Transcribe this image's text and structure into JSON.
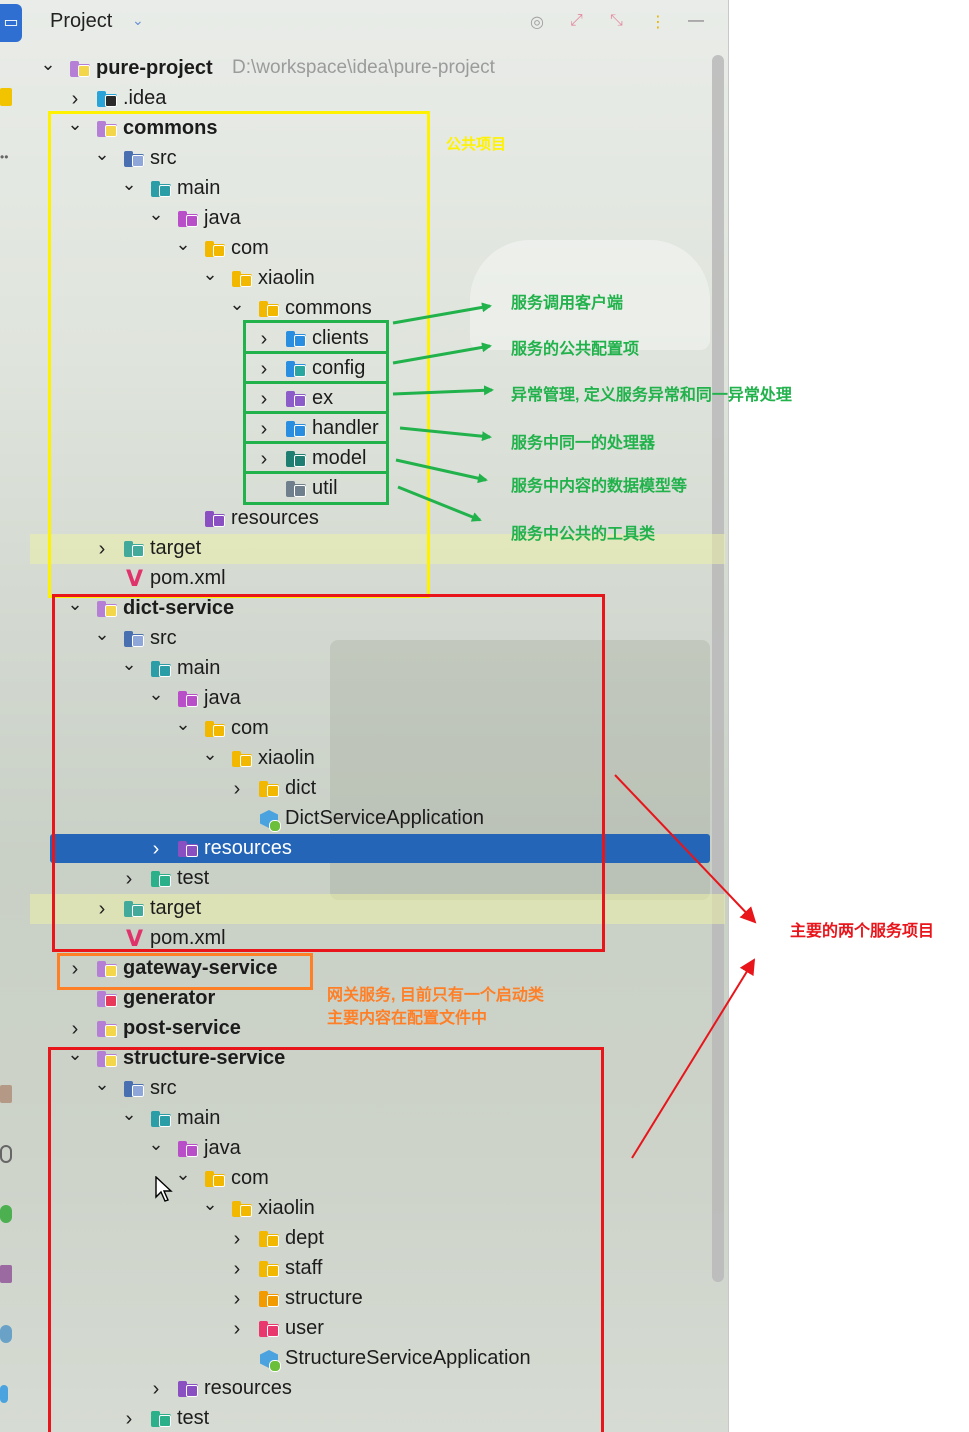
{
  "header": {
    "title": "Project",
    "chevron_icon": "chevron-down-icon",
    "icons": [
      "target-icon",
      "expand-icon",
      "collapse-icon",
      "more-vert-icon",
      "minimize-icon"
    ]
  },
  "tree": [
    {
      "depth": 0,
      "expanded": true,
      "icon": "module",
      "label": "pure-project",
      "bold": true,
      "path": "D:\\workspace\\idea\\pure-project"
    },
    {
      "depth": 1,
      "expanded": false,
      "icon": "idea",
      "label": ".idea"
    },
    {
      "depth": 1,
      "expanded": true,
      "icon": "module",
      "label": "commons",
      "bold": true
    },
    {
      "depth": 2,
      "expanded": true,
      "icon": "src",
      "label": "src"
    },
    {
      "depth": 3,
      "expanded": true,
      "icon": "main",
      "label": "main"
    },
    {
      "depth": 4,
      "expanded": true,
      "icon": "java",
      "label": "java"
    },
    {
      "depth": 5,
      "expanded": true,
      "icon": "package",
      "label": "com"
    },
    {
      "depth": 6,
      "expanded": true,
      "icon": "package",
      "label": "xiaolin"
    },
    {
      "depth": 7,
      "expanded": true,
      "icon": "package",
      "label": "commons"
    },
    {
      "depth": 8,
      "expanded": false,
      "icon": "clients",
      "label": "clients"
    },
    {
      "depth": 8,
      "expanded": false,
      "icon": "config",
      "label": "config"
    },
    {
      "depth": 8,
      "expanded": false,
      "icon": "ex",
      "label": "ex"
    },
    {
      "depth": 8,
      "expanded": false,
      "icon": "handler",
      "label": "handler"
    },
    {
      "depth": 8,
      "expanded": false,
      "icon": "model",
      "label": "model"
    },
    {
      "depth": 8,
      "expanded": null,
      "icon": "util",
      "label": "util"
    },
    {
      "depth": 5,
      "expanded": null,
      "icon": "resources",
      "label": "resources"
    },
    {
      "depth": 2,
      "expanded": false,
      "icon": "target",
      "label": "target"
    },
    {
      "depth": 2,
      "expanded": null,
      "icon": "maven",
      "label": "pom.xml"
    },
    {
      "depth": 1,
      "expanded": true,
      "icon": "module",
      "label": "dict-service",
      "bold": true
    },
    {
      "depth": 2,
      "expanded": true,
      "icon": "src",
      "label": "src"
    },
    {
      "depth": 3,
      "expanded": true,
      "icon": "main",
      "label": "main"
    },
    {
      "depth": 4,
      "expanded": true,
      "icon": "java",
      "label": "java"
    },
    {
      "depth": 5,
      "expanded": true,
      "icon": "package",
      "label": "com"
    },
    {
      "depth": 6,
      "expanded": true,
      "icon": "package",
      "label": "xiaolin"
    },
    {
      "depth": 7,
      "expanded": false,
      "icon": "package",
      "label": "dict"
    },
    {
      "depth": 7,
      "expanded": null,
      "icon": "springclass",
      "label": "DictServiceApplication"
    },
    {
      "depth": 4,
      "expanded": false,
      "icon": "resources",
      "label": "resources",
      "selected": true
    },
    {
      "depth": 3,
      "expanded": false,
      "icon": "test",
      "label": "test"
    },
    {
      "depth": 2,
      "expanded": false,
      "icon": "target",
      "label": "target"
    },
    {
      "depth": 2,
      "expanded": null,
      "icon": "maven",
      "label": "pom.xml"
    },
    {
      "depth": 1,
      "expanded": false,
      "icon": "module",
      "label": "gateway-service",
      "bold": true
    },
    {
      "depth": 1,
      "expanded": null,
      "icon": "module-red",
      "label": "generator",
      "bold": true
    },
    {
      "depth": 1,
      "expanded": false,
      "icon": "module",
      "label": "post-service",
      "bold": true
    },
    {
      "depth": 1,
      "expanded": true,
      "icon": "module",
      "label": "structure-service",
      "bold": true
    },
    {
      "depth": 2,
      "expanded": true,
      "icon": "src",
      "label": "src"
    },
    {
      "depth": 3,
      "expanded": true,
      "icon": "main",
      "label": "main"
    },
    {
      "depth": 4,
      "expanded": true,
      "icon": "java",
      "label": "java"
    },
    {
      "depth": 5,
      "expanded": true,
      "icon": "package",
      "label": "com"
    },
    {
      "depth": 6,
      "expanded": true,
      "icon": "package",
      "label": "xiaolin"
    },
    {
      "depth": 7,
      "expanded": false,
      "icon": "package",
      "label": "dept"
    },
    {
      "depth": 7,
      "expanded": false,
      "icon": "package",
      "label": "staff"
    },
    {
      "depth": 7,
      "expanded": false,
      "icon": "package-orange",
      "label": "structure"
    },
    {
      "depth": 7,
      "expanded": false,
      "icon": "package-pink",
      "label": "user"
    },
    {
      "depth": 7,
      "expanded": null,
      "icon": "springclass",
      "label": "StructureServiceApplication"
    },
    {
      "depth": 4,
      "expanded": false,
      "icon": "resources",
      "label": "resources"
    },
    {
      "depth": 3,
      "expanded": false,
      "icon": "test",
      "label": "test"
    }
  ],
  "annotations": {
    "commons_note": "公共项目",
    "pkg_notes": [
      "服务调用客户端",
      "服务的公共配置项",
      "异常管理, 定义服务异常和同一异常处理",
      "服务中同一的处理器",
      "服务中内容的数据模型等",
      "服务中公共的工具类"
    ],
    "main_services_note": "主要的两个服务项目",
    "gateway_note_line1": "网关服务, 目前只有一个启动类",
    "gateway_note_line2": "主要内容在配置文件中",
    "colors": {
      "yellow": "#fff200",
      "green": "#22b24c",
      "red": "#e8151b",
      "orange": "#ff7f27"
    }
  }
}
